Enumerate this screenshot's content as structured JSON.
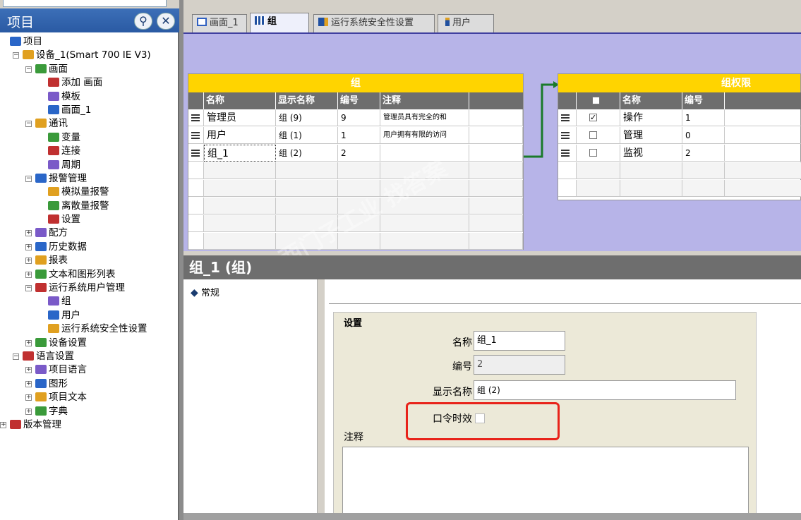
{
  "left_panel": {
    "title": "项目",
    "pin_icon": "pin-icon",
    "close_icon": "close-icon",
    "tree": [
      {
        "label": "项目",
        "level": 0
      },
      {
        "label": "设备_1(Smart 700 IE V3)",
        "level": 1
      },
      {
        "label": "画面",
        "level": 2
      },
      {
        "label": "添加 画面",
        "level": 3
      },
      {
        "label": "模板",
        "level": 3
      },
      {
        "label": "画面_1",
        "level": 3
      },
      {
        "label": "通讯",
        "level": 2
      },
      {
        "label": "变量",
        "level": 3
      },
      {
        "label": "连接",
        "level": 3
      },
      {
        "label": "周期",
        "level": 3
      },
      {
        "label": "报警管理",
        "level": 2
      },
      {
        "label": "模拟量报警",
        "level": 3
      },
      {
        "label": "离散量报警",
        "level": 3
      },
      {
        "label": "设置",
        "level": 3
      },
      {
        "label": "配方",
        "level": 2
      },
      {
        "label": "历史数据",
        "level": 2
      },
      {
        "label": "报表",
        "level": 2
      },
      {
        "label": "文本和图形列表",
        "level": 2
      },
      {
        "label": "运行系统用户管理",
        "level": 2
      },
      {
        "label": "组",
        "level": 3
      },
      {
        "label": "用户",
        "level": 3
      },
      {
        "label": "运行系统安全性设置",
        "level": 3
      },
      {
        "label": "设备设置",
        "level": 2
      },
      {
        "label": "语言设置",
        "level": 1
      },
      {
        "label": "项目语言",
        "level": 2
      },
      {
        "label": "图形",
        "level": 2
      },
      {
        "label": "项目文本",
        "level": 2
      },
      {
        "label": "字典",
        "level": 2
      },
      {
        "label": "版本管理",
        "level": 0
      }
    ]
  },
  "tabs": [
    {
      "label": "画面_1",
      "icon": "screen-icon"
    },
    {
      "label": "组",
      "icon": "group-icon"
    },
    {
      "label": "运行系统安全性设置",
      "icon": "security-icon"
    },
    {
      "label": "用户",
      "icon": "user-icon"
    }
  ],
  "groups_table": {
    "title": "组",
    "columns": [
      "名称",
      "显示名称",
      "编号",
      "注释"
    ],
    "rows": [
      {
        "name": "管理员",
        "display": "组 (9)",
        "number": "9",
        "comment": "管理员具有完全的和"
      },
      {
        "name": "用户",
        "display": "组 (1)",
        "number": "1",
        "comment": "用户拥有有限的访问"
      },
      {
        "name": "组_1",
        "display": "组 (2)",
        "number": "2",
        "comment": ""
      }
    ]
  },
  "permissions_table": {
    "title": "组权限",
    "columns": [
      "",
      "名称",
      "编号"
    ],
    "rows": [
      {
        "checked": true,
        "name": "操作",
        "number": "1"
      },
      {
        "checked": false,
        "name": "管理",
        "number": "0"
      },
      {
        "checked": false,
        "name": "监视",
        "number": "2"
      }
    ]
  },
  "properties": {
    "title": "组_1 (组)",
    "nav_item": "常规",
    "section_title": "设置",
    "name_label": "名称",
    "name_value": "组_1",
    "number_label": "编号",
    "number_value": "2",
    "display_label": "显示名称",
    "display_value": "组 (2)",
    "password_timeout_label": "口令时效",
    "comment_label": "注释",
    "highlight_color": "#e8231a"
  }
}
